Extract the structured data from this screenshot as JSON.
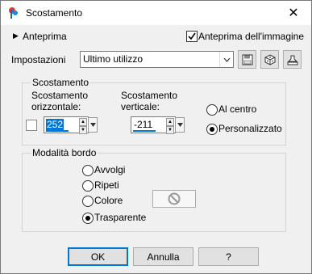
{
  "window": {
    "title": "Scostamento",
    "close_glyph": "✕"
  },
  "preview": {
    "expander_glyph": "▶",
    "label": "Anteprima",
    "image_preview_label": "Anteprima dell'immagine",
    "image_preview_checked": true
  },
  "settings": {
    "label": "Impostazioni",
    "selected": "Ultimo utilizzo"
  },
  "offset_group": {
    "title": "Scostamento",
    "horizontal_label_line1": "Scostamento",
    "horizontal_label_line2": "orizzontale:",
    "horizontal_value": "252",
    "vertical_label_line1": "Scostamento",
    "vertical_label_line2": "verticale:",
    "vertical_value": "-211",
    "center_label": "Al centro",
    "custom_label": "Personalizzato",
    "selected": "custom"
  },
  "edge_group": {
    "title": "Modalità bordo",
    "options": [
      "Avvolgi",
      "Ripeti",
      "Colore",
      "Trasparente"
    ],
    "selected": "Trasparente"
  },
  "buttons": {
    "ok": "OK",
    "cancel": "Annulla",
    "help": "?"
  },
  "colors": {
    "accent": "#0078d7",
    "window_bg": "#f0f0f0"
  }
}
